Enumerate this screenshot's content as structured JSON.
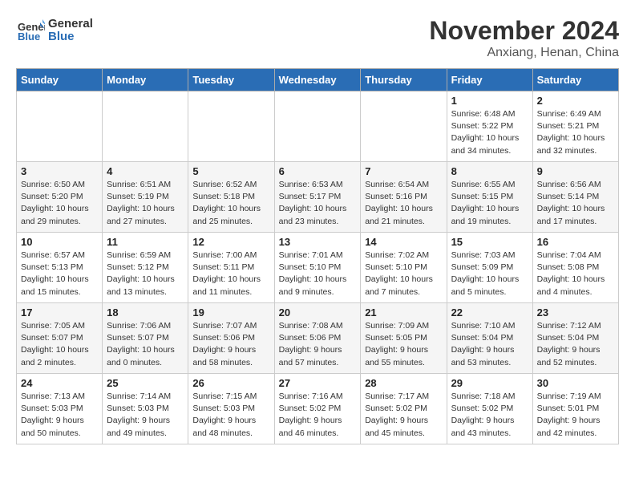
{
  "header": {
    "logo_line1": "General",
    "logo_line2": "Blue",
    "month": "November 2024",
    "location": "Anxiang, Henan, China"
  },
  "weekdays": [
    "Sunday",
    "Monday",
    "Tuesday",
    "Wednesday",
    "Thursday",
    "Friday",
    "Saturday"
  ],
  "weeks": [
    [
      {
        "day": "",
        "detail": ""
      },
      {
        "day": "",
        "detail": ""
      },
      {
        "day": "",
        "detail": ""
      },
      {
        "day": "",
        "detail": ""
      },
      {
        "day": "",
        "detail": ""
      },
      {
        "day": "1",
        "detail": "Sunrise: 6:48 AM\nSunset: 5:22 PM\nDaylight: 10 hours\nand 34 minutes."
      },
      {
        "day": "2",
        "detail": "Sunrise: 6:49 AM\nSunset: 5:21 PM\nDaylight: 10 hours\nand 32 minutes."
      }
    ],
    [
      {
        "day": "3",
        "detail": "Sunrise: 6:50 AM\nSunset: 5:20 PM\nDaylight: 10 hours\nand 29 minutes."
      },
      {
        "day": "4",
        "detail": "Sunrise: 6:51 AM\nSunset: 5:19 PM\nDaylight: 10 hours\nand 27 minutes."
      },
      {
        "day": "5",
        "detail": "Sunrise: 6:52 AM\nSunset: 5:18 PM\nDaylight: 10 hours\nand 25 minutes."
      },
      {
        "day": "6",
        "detail": "Sunrise: 6:53 AM\nSunset: 5:17 PM\nDaylight: 10 hours\nand 23 minutes."
      },
      {
        "day": "7",
        "detail": "Sunrise: 6:54 AM\nSunset: 5:16 PM\nDaylight: 10 hours\nand 21 minutes."
      },
      {
        "day": "8",
        "detail": "Sunrise: 6:55 AM\nSunset: 5:15 PM\nDaylight: 10 hours\nand 19 minutes."
      },
      {
        "day": "9",
        "detail": "Sunrise: 6:56 AM\nSunset: 5:14 PM\nDaylight: 10 hours\nand 17 minutes."
      }
    ],
    [
      {
        "day": "10",
        "detail": "Sunrise: 6:57 AM\nSunset: 5:13 PM\nDaylight: 10 hours\nand 15 minutes."
      },
      {
        "day": "11",
        "detail": "Sunrise: 6:59 AM\nSunset: 5:12 PM\nDaylight: 10 hours\nand 13 minutes."
      },
      {
        "day": "12",
        "detail": "Sunrise: 7:00 AM\nSunset: 5:11 PM\nDaylight: 10 hours\nand 11 minutes."
      },
      {
        "day": "13",
        "detail": "Sunrise: 7:01 AM\nSunset: 5:10 PM\nDaylight: 10 hours\nand 9 minutes."
      },
      {
        "day": "14",
        "detail": "Sunrise: 7:02 AM\nSunset: 5:10 PM\nDaylight: 10 hours\nand 7 minutes."
      },
      {
        "day": "15",
        "detail": "Sunrise: 7:03 AM\nSunset: 5:09 PM\nDaylight: 10 hours\nand 5 minutes."
      },
      {
        "day": "16",
        "detail": "Sunrise: 7:04 AM\nSunset: 5:08 PM\nDaylight: 10 hours\nand 4 minutes."
      }
    ],
    [
      {
        "day": "17",
        "detail": "Sunrise: 7:05 AM\nSunset: 5:07 PM\nDaylight: 10 hours\nand 2 minutes."
      },
      {
        "day": "18",
        "detail": "Sunrise: 7:06 AM\nSunset: 5:07 PM\nDaylight: 10 hours\nand 0 minutes."
      },
      {
        "day": "19",
        "detail": "Sunrise: 7:07 AM\nSunset: 5:06 PM\nDaylight: 9 hours\nand 58 minutes."
      },
      {
        "day": "20",
        "detail": "Sunrise: 7:08 AM\nSunset: 5:06 PM\nDaylight: 9 hours\nand 57 minutes."
      },
      {
        "day": "21",
        "detail": "Sunrise: 7:09 AM\nSunset: 5:05 PM\nDaylight: 9 hours\nand 55 minutes."
      },
      {
        "day": "22",
        "detail": "Sunrise: 7:10 AM\nSunset: 5:04 PM\nDaylight: 9 hours\nand 53 minutes."
      },
      {
        "day": "23",
        "detail": "Sunrise: 7:12 AM\nSunset: 5:04 PM\nDaylight: 9 hours\nand 52 minutes."
      }
    ],
    [
      {
        "day": "24",
        "detail": "Sunrise: 7:13 AM\nSunset: 5:03 PM\nDaylight: 9 hours\nand 50 minutes."
      },
      {
        "day": "25",
        "detail": "Sunrise: 7:14 AM\nSunset: 5:03 PM\nDaylight: 9 hours\nand 49 minutes."
      },
      {
        "day": "26",
        "detail": "Sunrise: 7:15 AM\nSunset: 5:03 PM\nDaylight: 9 hours\nand 48 minutes."
      },
      {
        "day": "27",
        "detail": "Sunrise: 7:16 AM\nSunset: 5:02 PM\nDaylight: 9 hours\nand 46 minutes."
      },
      {
        "day": "28",
        "detail": "Sunrise: 7:17 AM\nSunset: 5:02 PM\nDaylight: 9 hours\nand 45 minutes."
      },
      {
        "day": "29",
        "detail": "Sunrise: 7:18 AM\nSunset: 5:02 PM\nDaylight: 9 hours\nand 43 minutes."
      },
      {
        "day": "30",
        "detail": "Sunrise: 7:19 AM\nSunset: 5:01 PM\nDaylight: 9 hours\nand 42 minutes."
      }
    ]
  ]
}
